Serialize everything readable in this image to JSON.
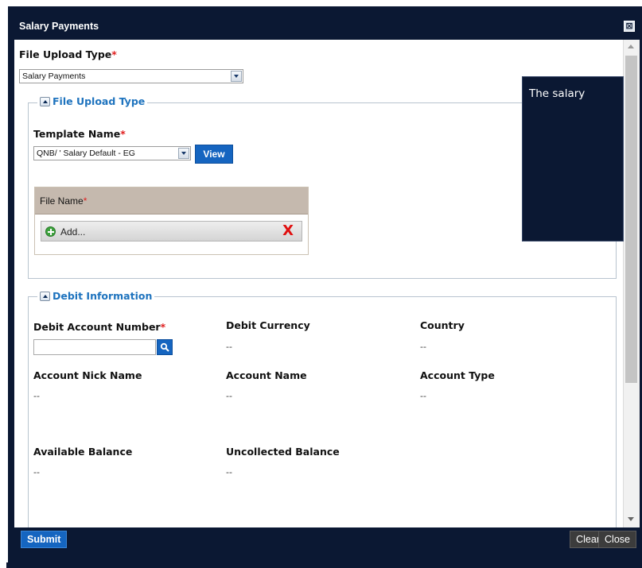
{
  "dialog": {
    "title": "Salary Payments",
    "close_glyph": "⊠"
  },
  "upload_type": {
    "label": "File Upload Type",
    "required_mark": "*",
    "selected": "Salary Payments"
  },
  "file_upload_section": {
    "legend": "File Upload Type",
    "template_label": "Template Name",
    "required_mark": "*",
    "template_selected": "QNB/ '  Salary Default - EG",
    "view_label": "View",
    "file_name_label": "File Name",
    "file_required_mark": "*",
    "add_label": "Add...",
    "remove_glyph": "X"
  },
  "debit_section": {
    "legend": "Debit Information",
    "debit_account_label": "Debit Account Number",
    "required_mark": "*",
    "debit_account_value": "",
    "debit_currency_label": "Debit Currency",
    "debit_currency_value": "--",
    "country_label": "Country",
    "country_value": "--",
    "nick_name_label": "Account Nick Name",
    "nick_name_value": "--",
    "account_name_label": "Account Name",
    "account_name_value": "--",
    "account_type_label": "Account Type",
    "account_type_value": "--",
    "available_balance_label": "Available Balance",
    "available_balance_value": "--",
    "uncollected_balance_label": "Uncollected Balance",
    "uncollected_balance_value": "--"
  },
  "tooltip": {
    "text": "The salary"
  },
  "footer": {
    "submit_label": "Submit",
    "clear_label": "Clear",
    "close_label": "Close"
  },
  "colors": {
    "titlebar": "#0b1833",
    "accent": "#1565c0",
    "legend": "#1e73be",
    "required": "#e02020",
    "file_header": "#c5b9ae"
  }
}
